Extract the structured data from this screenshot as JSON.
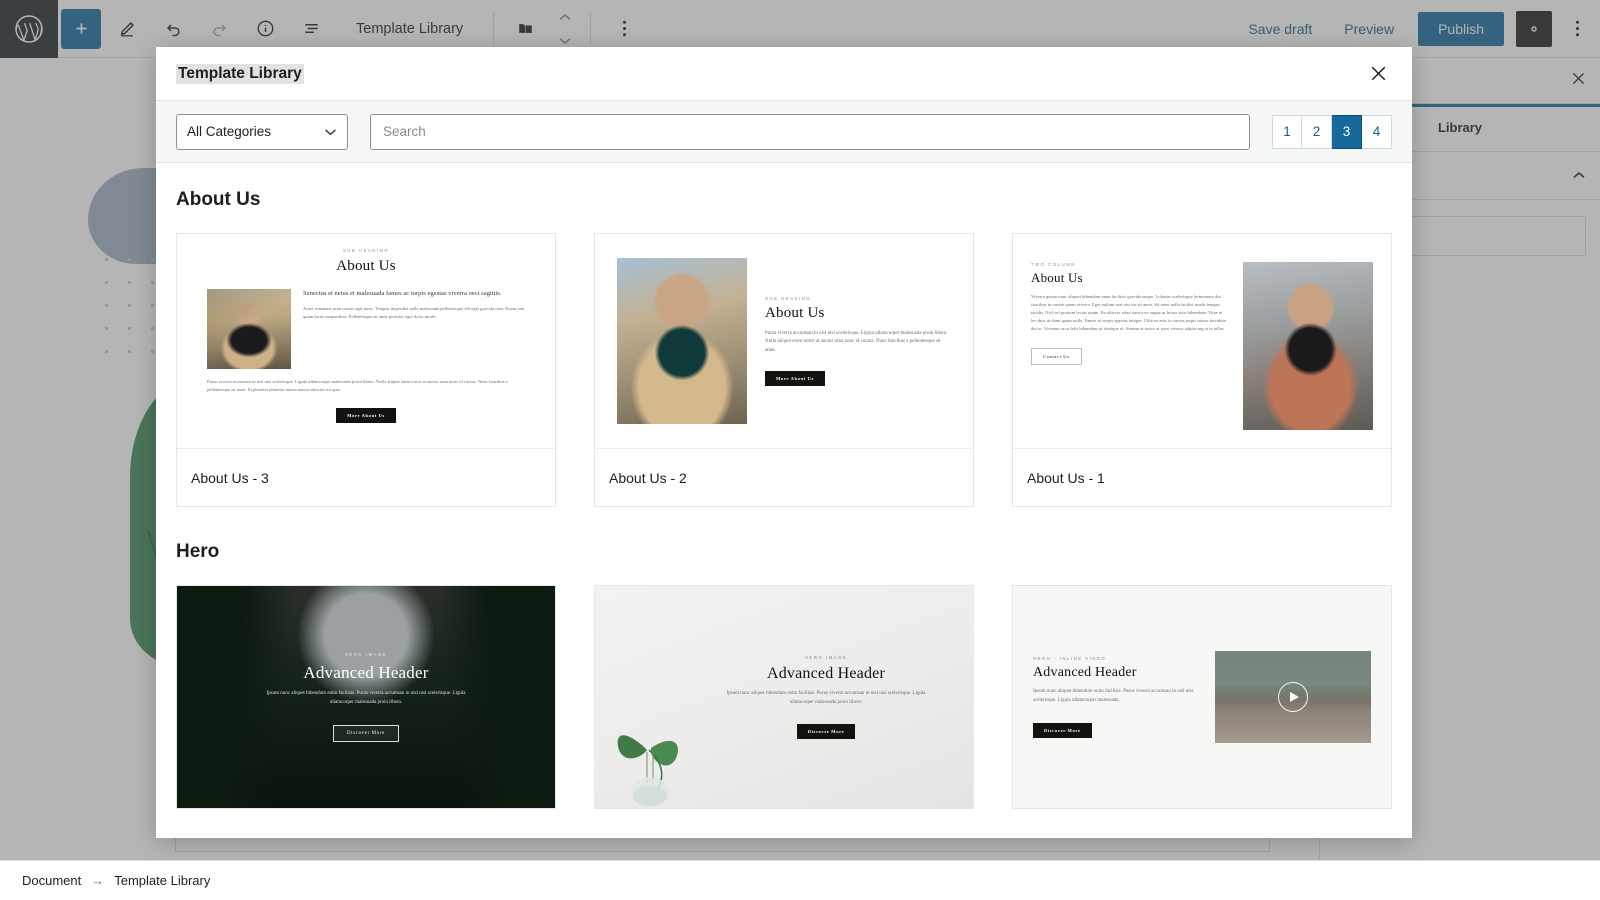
{
  "toolbar": {
    "logo_icon": "wordpress-logo-icon",
    "add_block_icon": "plus-icon",
    "edit_icon": "pencil-icon",
    "undo_icon": "undo-arrow-icon",
    "redo_icon": "redo-arrow-icon",
    "info_icon": "info-circle-icon",
    "list_view_icon": "list-view-icon",
    "document_title": "Template Library",
    "folder_icon": "folder-icon",
    "stepper_up_icon": "chevron-up-icon",
    "stepper_down_icon": "chevron-down-icon",
    "kebab_icon": "more-vertical-icon",
    "save_draft_label": "Save draft",
    "preview_label": "Preview",
    "publish_label": "Publish",
    "settings_icon": "gear-icon",
    "options_icon": "more-vertical-icon",
    "accent_color": "#16699b",
    "link_color": "#175e8e"
  },
  "sidebar": {
    "close_icon": "close-x-icon",
    "tab_label": "Library",
    "collapse_icon": "chevron-up-icon"
  },
  "statusbar": {
    "document_label": "Document",
    "arrow": "→",
    "current_label": "Template Library"
  },
  "modal": {
    "title": "Template Library",
    "close_icon": "close-x-icon",
    "filter": {
      "category_value": "All Categories",
      "category_chevron_icon": "chevron-down-icon",
      "search_value": "",
      "search_placeholder": "Search"
    },
    "pagination": {
      "pages": [
        "1",
        "2",
        "3",
        "4"
      ],
      "active": "3",
      "active_color": "#16699b"
    },
    "sections": [
      {
        "title": "About Us",
        "cards": [
          {
            "caption": "About Us - 3",
            "layout": "about-3",
            "kicker": "SUB HEADING",
            "heading": "About Us",
            "lead": "Senectus et netus et malesuada fames ac turpis egestas viverra oeci sagittis.",
            "body": "Amet venenatis urna cursus eget nunc. Tempus imperdiet nulla malesuada pellentesque elit eget gravida cum. Etiam non quam lacus suspendisse. Pellentesque sit amet porttitor eget dolor morbi.",
            "body2": "Purus viverra accumsan in nisl nisi scelerisque. Ligula ullamcorper malesuada proin libero. Nulla aliquet enim tortor at auctor urna nunc id cursus. Nunc faucibus a pellentesque sit amet. Et pharetra pharetra massa massa ultricies mi quis.",
            "button": "More About Us",
            "button_style": "dark",
            "photo": "man-in-tan-coat-street"
          },
          {
            "caption": "About Us - 2",
            "layout": "about-2",
            "kicker": "SUB HEADING",
            "heading": "About Us",
            "body": "Purus viverra accumsan in nisl nisi scelerisque. Ligula ullamcorper malesuada proin libero. Nulla aliquet enim tortor at auctor urna nunc id cursus. Nunc faucibus a pellentesque sit amet.",
            "button": "More About Us",
            "button_style": "dark",
            "photo": "man-with-glasses-portrait"
          },
          {
            "caption": "About Us - 1",
            "layout": "about-1",
            "kicker": "TWO COLUMN",
            "heading": "About Us",
            "body": "Viverra ipsum nunc aliquet bibendum enim facilisis gravida neque. Lobortis scelerisque fermentum dui faucibus in ornare quam viverra. Eget nullam non nisi est sit amet. Sit amet nulla facilisi morbi tempus iaculis. Nisl vel pretium lectus quam. Eu ultrices vitae auctor eu augue ut lectus arcu bibendum. Vitae et leo duis ut diam quam nulla. Fames ac turpis egestas integer. Ultrices eros in cursus turpis massa tincidunt dui ut. Vivamus arcu felis bibendum ut tristique et. Aenean et tortor at risus viverra adipiscing at in tellus.",
            "button": "Contact Us",
            "button_style": "outline",
            "photo": "man-drinking-coffee-alley"
          }
        ]
      },
      {
        "title": "Hero",
        "cards": [
          {
            "caption": "",
            "layout": "hero-dark",
            "kicker": "HERO IMAGE",
            "heading": "Advanced Header",
            "body": "Ipsum nunc aliquet bibendum enim facilisis. Purus viverra accumsan in nisl nisi scelerisque. Ligula ullamcorper malesuada proin libero.",
            "button": "Discover More",
            "button_style": "outline-light",
            "photo": "dark-city-street-trees"
          },
          {
            "caption": "",
            "layout": "hero-light",
            "kicker": "HERO IMAGE",
            "heading": "Advanced Header",
            "body": "Ipsum nunc aliquet bibendum enim facilisis. Purus viverra accumsan in nisl nisi scelerisque. Ligula ullamcorper malesuada proin libero.",
            "button": "Discover More",
            "button_style": "dark",
            "photo": "plant-in-glass-vase"
          },
          {
            "caption": "",
            "layout": "hero-video",
            "kicker": "HERO - INLINE VIDEO",
            "heading": "Advanced Header",
            "body": "Ipsum nunc aliquet bibendum enim facilisis. Purus viverra accumsan in nisl nisi scelerisque. Ligula ullamcorper malesuada.",
            "button": "Discover More",
            "button_style": "dark",
            "photo": "foggy-forest-fence-video",
            "play_icon": "play-circle-icon"
          }
        ]
      }
    ]
  }
}
